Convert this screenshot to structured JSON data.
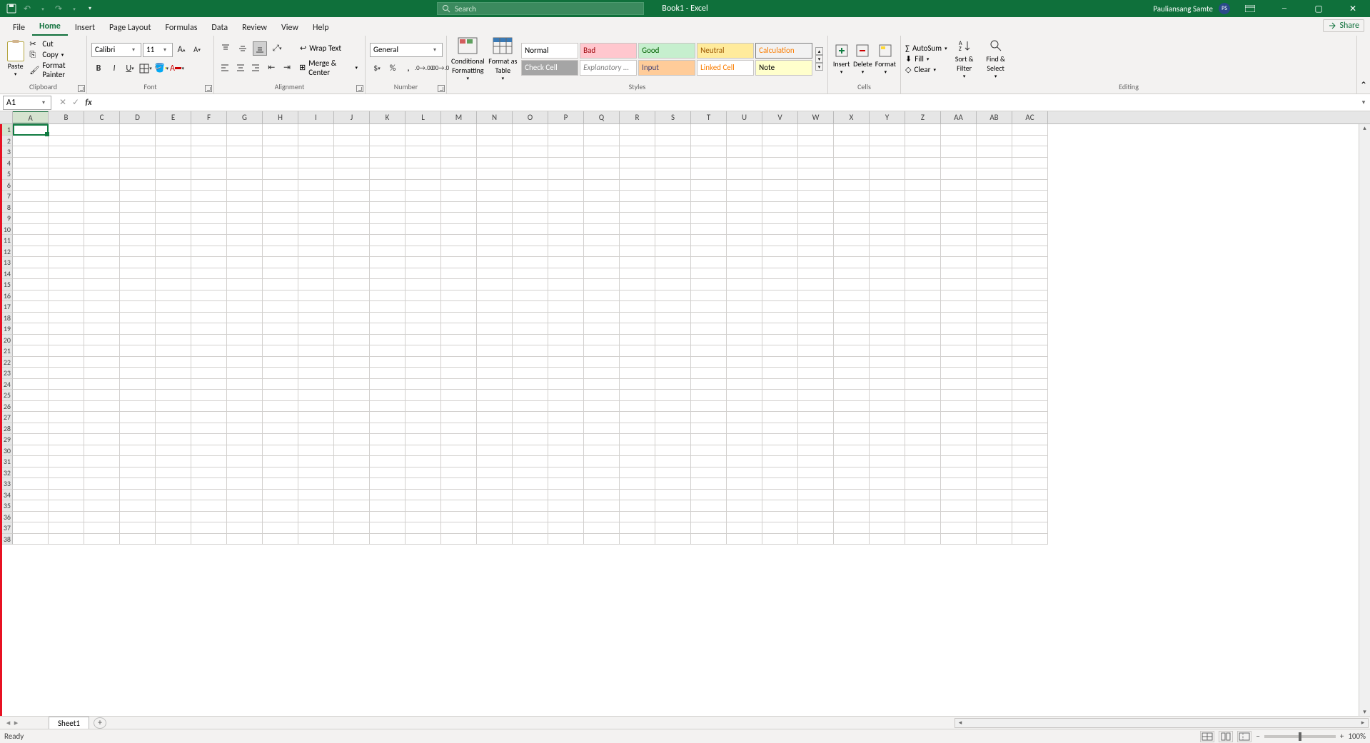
{
  "titlebar": {
    "title": "Book1  -  Excel",
    "search_placeholder": "Search",
    "username": "Pauliansang Samte",
    "avatar_initials": "PS"
  },
  "tabs": {
    "file": "File",
    "home": "Home",
    "insert": "Insert",
    "page_layout": "Page Layout",
    "formulas": "Formulas",
    "data": "Data",
    "review": "Review",
    "view": "View",
    "help": "Help",
    "share": "Share"
  },
  "ribbon": {
    "clipboard": {
      "label": "Clipboard",
      "paste": "Paste",
      "cut": "Cut",
      "copy": "Copy",
      "format_painter": "Format Painter"
    },
    "font": {
      "label": "Font",
      "name": "Calibri",
      "size": "11"
    },
    "alignment": {
      "label": "Alignment",
      "wrap": "Wrap Text",
      "merge": "Merge & Center"
    },
    "number": {
      "label": "Number",
      "format": "General"
    },
    "styles": {
      "label": "Styles",
      "cond": "Conditional Formatting",
      "fat": "Format as Table",
      "normal": "Normal",
      "bad": "Bad",
      "good": "Good",
      "neutral": "Neutral",
      "calc": "Calculation",
      "check": "Check Cell",
      "expl": "Explanatory ...",
      "input": "Input",
      "linked": "Linked Cell",
      "note": "Note"
    },
    "cells": {
      "label": "Cells",
      "insert": "Insert",
      "delete": "Delete",
      "format": "Format"
    },
    "editing": {
      "label": "Editing",
      "autosum": "AutoSum",
      "fill": "Fill",
      "clear": "Clear",
      "sort": "Sort & Filter",
      "find": "Find & Select"
    }
  },
  "formula_bar": {
    "cell_ref": "A1",
    "formula": ""
  },
  "grid": {
    "columns": [
      "A",
      "B",
      "C",
      "D",
      "E",
      "F",
      "G",
      "H",
      "I",
      "J",
      "K",
      "L",
      "M",
      "N",
      "O",
      "P",
      "Q",
      "R",
      "S",
      "T",
      "U",
      "V",
      "W",
      "X",
      "Y",
      "Z",
      "AA",
      "AB",
      "AC"
    ],
    "visible_rows": 38,
    "active_cell": "A1"
  },
  "sheets": {
    "active": "Sheet1"
  },
  "status": {
    "ready": "Ready",
    "zoom": "100%"
  }
}
